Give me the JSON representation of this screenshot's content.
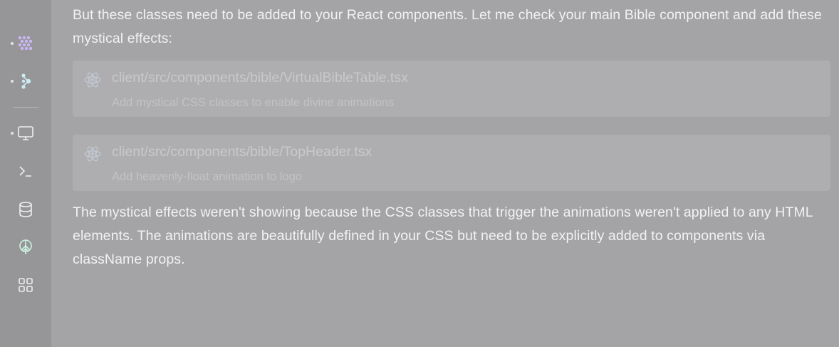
{
  "sidebar": {
    "icons": [
      {
        "name": "agent-icon",
        "has_dot": true
      },
      {
        "name": "assistant-icon",
        "has_dot": true
      },
      {
        "name": "preview-icon",
        "has_dot": true
      },
      {
        "name": "shell-icon",
        "has_dot": false
      },
      {
        "name": "database-icon",
        "has_dot": false
      },
      {
        "name": "deployments-icon",
        "has_dot": false
      },
      {
        "name": "all-tools-icon",
        "has_dot": false
      }
    ]
  },
  "message": {
    "intro": "But these classes need to be added to your React components. Let me check your main Bible component and add these mystical effects:",
    "files": [
      {
        "path": "client/src/components/bible/VirtualBibleTable.tsx",
        "description": "Add mystical CSS classes to enable divine animations",
        "icon": "react-icon"
      },
      {
        "path": "client/src/components/bible/TopHeader.tsx",
        "description": "Add heavenly-float animation to logo",
        "icon": "react-icon"
      }
    ],
    "conclusion": "The mystical effects weren't showing because the CSS classes that trigger the animations weren't applied to any HTML elements. The animations are beautifully defined in your CSS but need to be explicitly added to components via className props."
  },
  "colors": {
    "page_background": "#a4a4a6",
    "sidebar_background": "#969698",
    "accent_purple": "#c9b8f5",
    "accent_teal": "#cdeaf2",
    "text": "#f2f2f4"
  }
}
